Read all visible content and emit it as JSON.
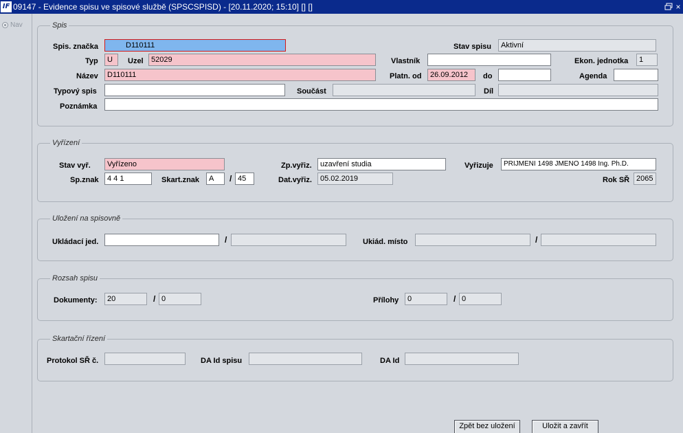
{
  "window": {
    "title": "09147 - Evidence spisu ve spisové službě (SPSCSPISD) - [20.11.2020; 15:10] [] []",
    "app_icon": "IF"
  },
  "nav": {
    "label": "Nav"
  },
  "spis": {
    "title": "Spis",
    "spis_znacka_label": "Spis. značka",
    "spis_znacka_value": "D110111",
    "stav_spisu_label": "Stav spisu",
    "stav_spisu_value": "Aktivní",
    "typ_label": "Typ",
    "typ_value": "U",
    "uzel_label": "Uzel",
    "uzel_value": "52029",
    "vlastnik_label": "Vlastník",
    "vlastnik_value": "",
    "ekon_label": "Ekon. jednotka",
    "ekon_value": "1",
    "nazev_label": "Název",
    "nazev_value": "D110111",
    "platn_od_label": "Platn. od",
    "platn_od_value": "26.09.2012",
    "do_label": "do",
    "do_value": "",
    "agenda_label": "Agenda",
    "agenda_value": "",
    "typovy_label": "Typový spis",
    "typovy_value": "",
    "soucast_label": "Součást",
    "soucast_value": "",
    "dil_label": "Díl",
    "dil_value": "",
    "poznamka_label": "Poznámka",
    "poznamka_value": ""
  },
  "vyrizeni": {
    "title": "Vyřízení",
    "stav_vyr_label": "Stav vyř.",
    "stav_vyr_value": "Vyřízeno",
    "zp_vyriz_label": "Zp.vyřiz.",
    "zp_vyriz_value": "uzavření studia",
    "vyrizuje_label": "Vyřizuje",
    "vyrizuje_value": "PRIJMENI 1498 JMENO 1498 Ing. Ph.D.",
    "sp_znak_label": "Sp.znak",
    "sp_znak_value": "4 4 1",
    "skart_znak_label": "Skart.znak",
    "skart_znak_value": "A",
    "skart_lhuta_value": "45",
    "slash": "/",
    "dat_vyriz_label": "Dat.vyřiz.",
    "dat_vyriz_value": "05.02.2019",
    "rok_sr_label": "Rok SŘ",
    "rok_sr_value": "2065"
  },
  "ulozeni": {
    "title": "Uložení na spisovně",
    "ukladaci_jed_label": "Ukládací jed.",
    "ukladaci_jed_value": "",
    "ukladaci_jed_value2": "",
    "uklad_misto_label": "Ukiád. místo",
    "uklad_misto_value": "",
    "uklad_misto_value2": "",
    "slash": "/"
  },
  "rozsah": {
    "title": "Rozsah spisu",
    "dokumenty_label": "Dokumenty:",
    "dokumenty_value": "20",
    "dokumenty_value2": "0",
    "prilohy_label": "Přílohy",
    "prilohy_value": "0",
    "prilohy_value2": "0",
    "slash": "/"
  },
  "skartacni": {
    "title": "Skartační řízení",
    "protokol_label": "Protokol SŘ č.",
    "protokol_value": "",
    "da_id_spisu_label": "DA Id spisu",
    "da_id_spisu_value": "",
    "da_id_label": "DA Id",
    "da_id_value": ""
  },
  "buttons": {
    "back_label": "Zpět bez uložení",
    "save_label": "Uložit a zavřít"
  },
  "colors": {
    "titlebar": "#0a2a8c",
    "required_field": "#f6c4cb",
    "focused_field": "#7fb6ee",
    "background": "#d4d8de"
  }
}
